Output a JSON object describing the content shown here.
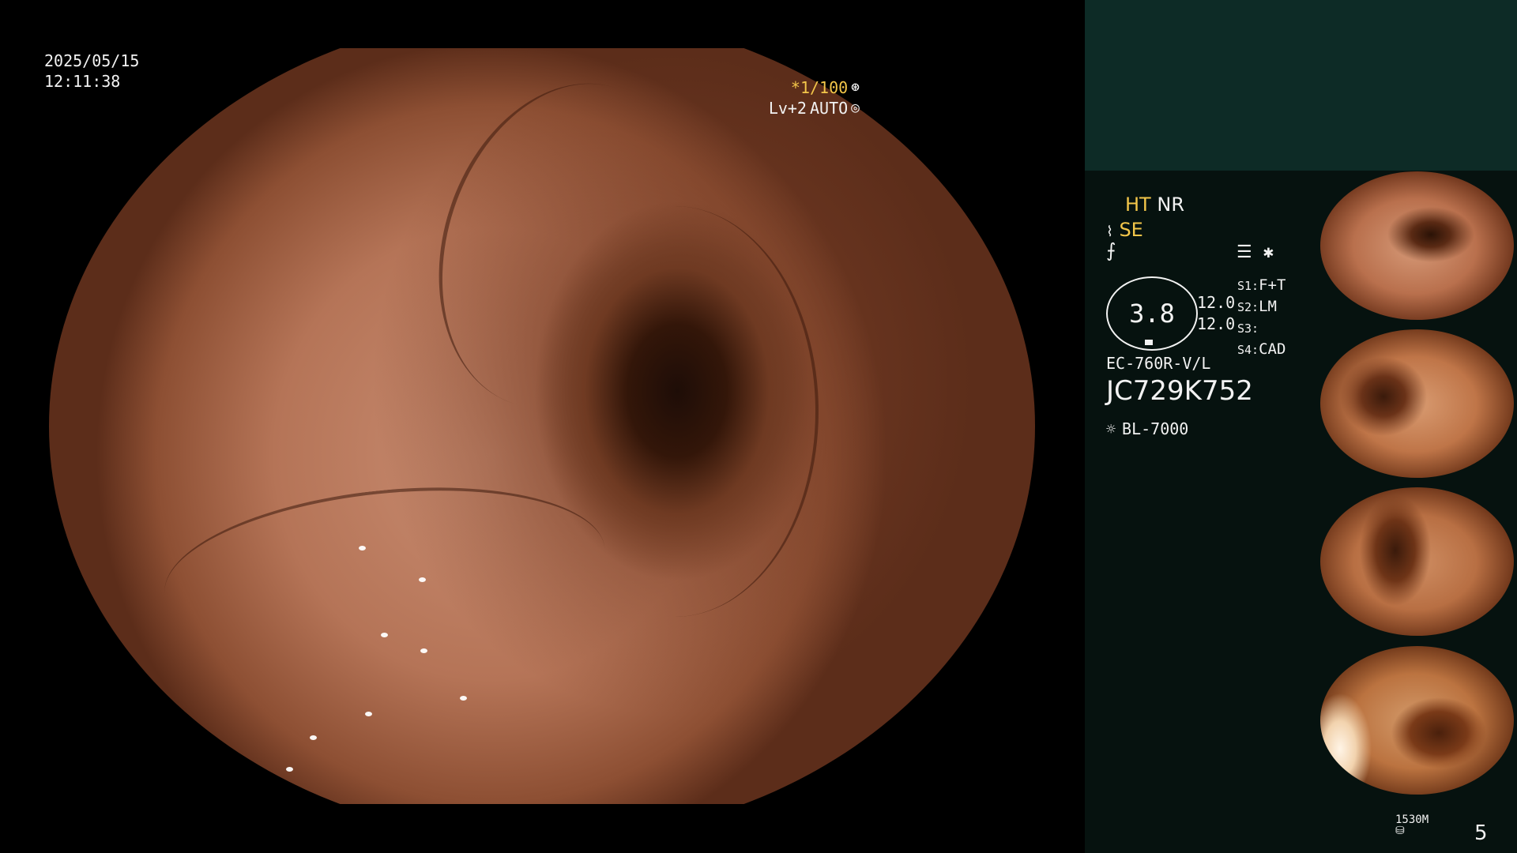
{
  "overlay": {
    "date": "2025/05/15",
    "time": "12:11:38",
    "shutter": "*1/100",
    "light_level": "Lv+2",
    "exposure_mode": "AUTO"
  },
  "panel": {
    "mode_ht": "HT",
    "mode_nr": "NR",
    "mode_se": "SE",
    "scale_value": "3.8",
    "scale_val_1": "12.0",
    "scale_val_2": "12.0",
    "switches": [
      {
        "key": "S1:",
        "value": "F+T"
      },
      {
        "key": "S2:",
        "value": "LM"
      },
      {
        "key": "S3:",
        "value": ""
      },
      {
        "key": "S4:",
        "value": "CAD"
      }
    ],
    "scope_model": "EC-760R-V/L",
    "serial": "JC729K752",
    "light_source": "BL-7000",
    "storage": "1530M",
    "frame_count": "5"
  },
  "icons": {
    "shutter": "aperture-icon",
    "exposure": "auto-iris-icon",
    "enhance": "edge-enhance-icon",
    "structure": "structure-icon",
    "light": "lamp-icon",
    "storage": "disk-icon"
  },
  "colors": {
    "accent_yellow": "#f3c64a",
    "panel_bg": "#06120f",
    "panel_header": "#0d2b26"
  }
}
